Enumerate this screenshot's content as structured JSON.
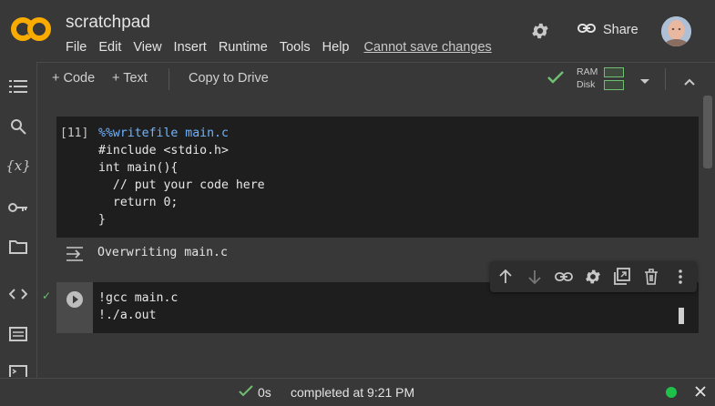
{
  "header": {
    "title": "scratchpad",
    "menu": [
      "File",
      "Edit",
      "View",
      "Insert",
      "Runtime",
      "Tools",
      "Help"
    ],
    "save_warning": "Cannot save changes",
    "share_label": "Share"
  },
  "toolbar": {
    "add_code_label": "+ Code",
    "add_text_label": "+ Text",
    "copy_to_drive_label": "Copy to Drive",
    "ram_label": "RAM",
    "disk_label": "Disk"
  },
  "sidebar": {
    "items": [
      "table-of-contents-icon",
      "search-icon",
      "variables-icon",
      "secrets-key-icon",
      "files-folder-icon",
      "code-snippets-icon",
      "command-palette-icon",
      "terminal-icon"
    ]
  },
  "cells": [
    {
      "prompt": "[11]",
      "magic": "%%writefile main.c",
      "lines": [
        "#include <stdio.h>",
        "int main(){",
        "  // put your code here",
        "  return 0;",
        "}"
      ],
      "output": "Overwriting main.c"
    },
    {
      "lines": [
        "!gcc main.c",
        "!./a.out"
      ]
    }
  ],
  "status": {
    "duration": "0s",
    "completed": "completed at 9:21 PM"
  },
  "colors": {
    "accent_orange": "#f9ab00",
    "success_green": "#6fbf73",
    "magic_blue": "#6fb3ff"
  }
}
